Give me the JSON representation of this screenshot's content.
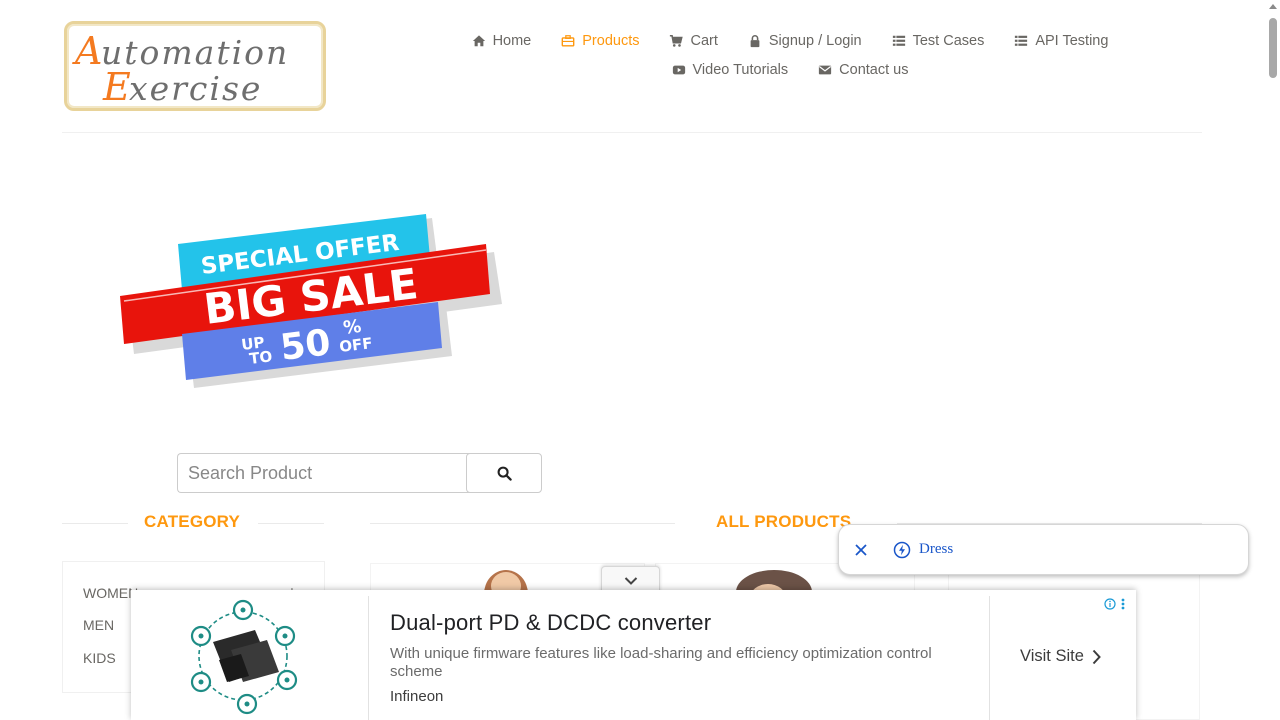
{
  "logo": {
    "line1": "Automation",
    "line2": "Exercise",
    "accent_color": "#f47a20"
  },
  "nav": {
    "row1": [
      {
        "label": "Home",
        "icon": "home-icon"
      },
      {
        "label": "Products",
        "icon": "briefcase-icon",
        "active": true
      },
      {
        "label": "Cart",
        "icon": "cart-icon"
      },
      {
        "label": "Signup / Login",
        "icon": "lock-icon"
      },
      {
        "label": "Test Cases",
        "icon": "list-icon"
      },
      {
        "label": "API Testing",
        "icon": "list-icon"
      }
    ],
    "row2": [
      {
        "label": "Video Tutorials",
        "icon": "youtube-icon"
      },
      {
        "label": "Contact us",
        "icon": "envelope-icon"
      }
    ]
  },
  "banner": {
    "line1": "SPECIAL OFFER",
    "line2": "BIG SALE",
    "line3a": "UP",
    "line3b": "TO",
    "line3c": "50",
    "line3d": "%",
    "line3e": "OFF"
  },
  "search": {
    "placeholder": "Search Product",
    "value": ""
  },
  "sections": {
    "category_title": "CATEGORY",
    "products_title": "ALL PRODUCTS"
  },
  "categories": [
    {
      "label": "WOMEN",
      "expand": "+"
    },
    {
      "label": "MEN",
      "expand": ""
    },
    {
      "label": "KIDS",
      "expand": ""
    }
  ],
  "suggestion": {
    "label": "Dress"
  },
  "ad": {
    "title": "Dual-port PD & DCDC converter",
    "description": "With unique firmware features like load-sharing and efficiency optimization control scheme",
    "brand": "Infineon",
    "cta": "Visit Site"
  },
  "colors": {
    "accent": "#FE980F",
    "text": "#696763",
    "link_blue": "#1a56c9"
  }
}
